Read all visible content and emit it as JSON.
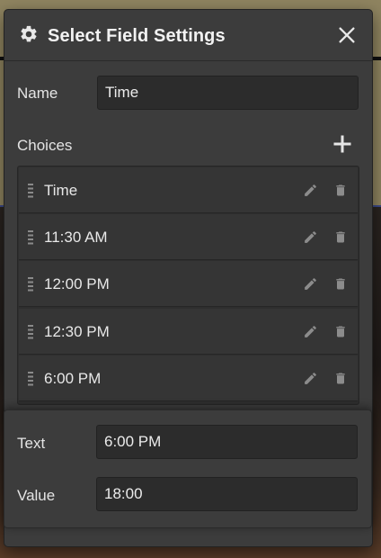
{
  "dialog": {
    "title": "Select Field Settings",
    "icon": "gear-icon",
    "close_icon": "close-icon"
  },
  "name_field": {
    "label": "Name",
    "value": "Time"
  },
  "choices": {
    "label": "Choices",
    "add_icon": "plus-icon",
    "items": [
      {
        "text": "Time"
      },
      {
        "text": "11:30 AM"
      },
      {
        "text": "12:00 PM"
      },
      {
        "text": "12:30 PM"
      },
      {
        "text": "6:00 PM"
      }
    ]
  },
  "edit_choice": {
    "text_label": "Text",
    "text_value": "6:00 PM",
    "value_label": "Value",
    "value_value": "18:00"
  },
  "colors": {
    "background_top": "#8f8460",
    "modal": "#3c3c3c",
    "input": "#2c2c2c"
  }
}
